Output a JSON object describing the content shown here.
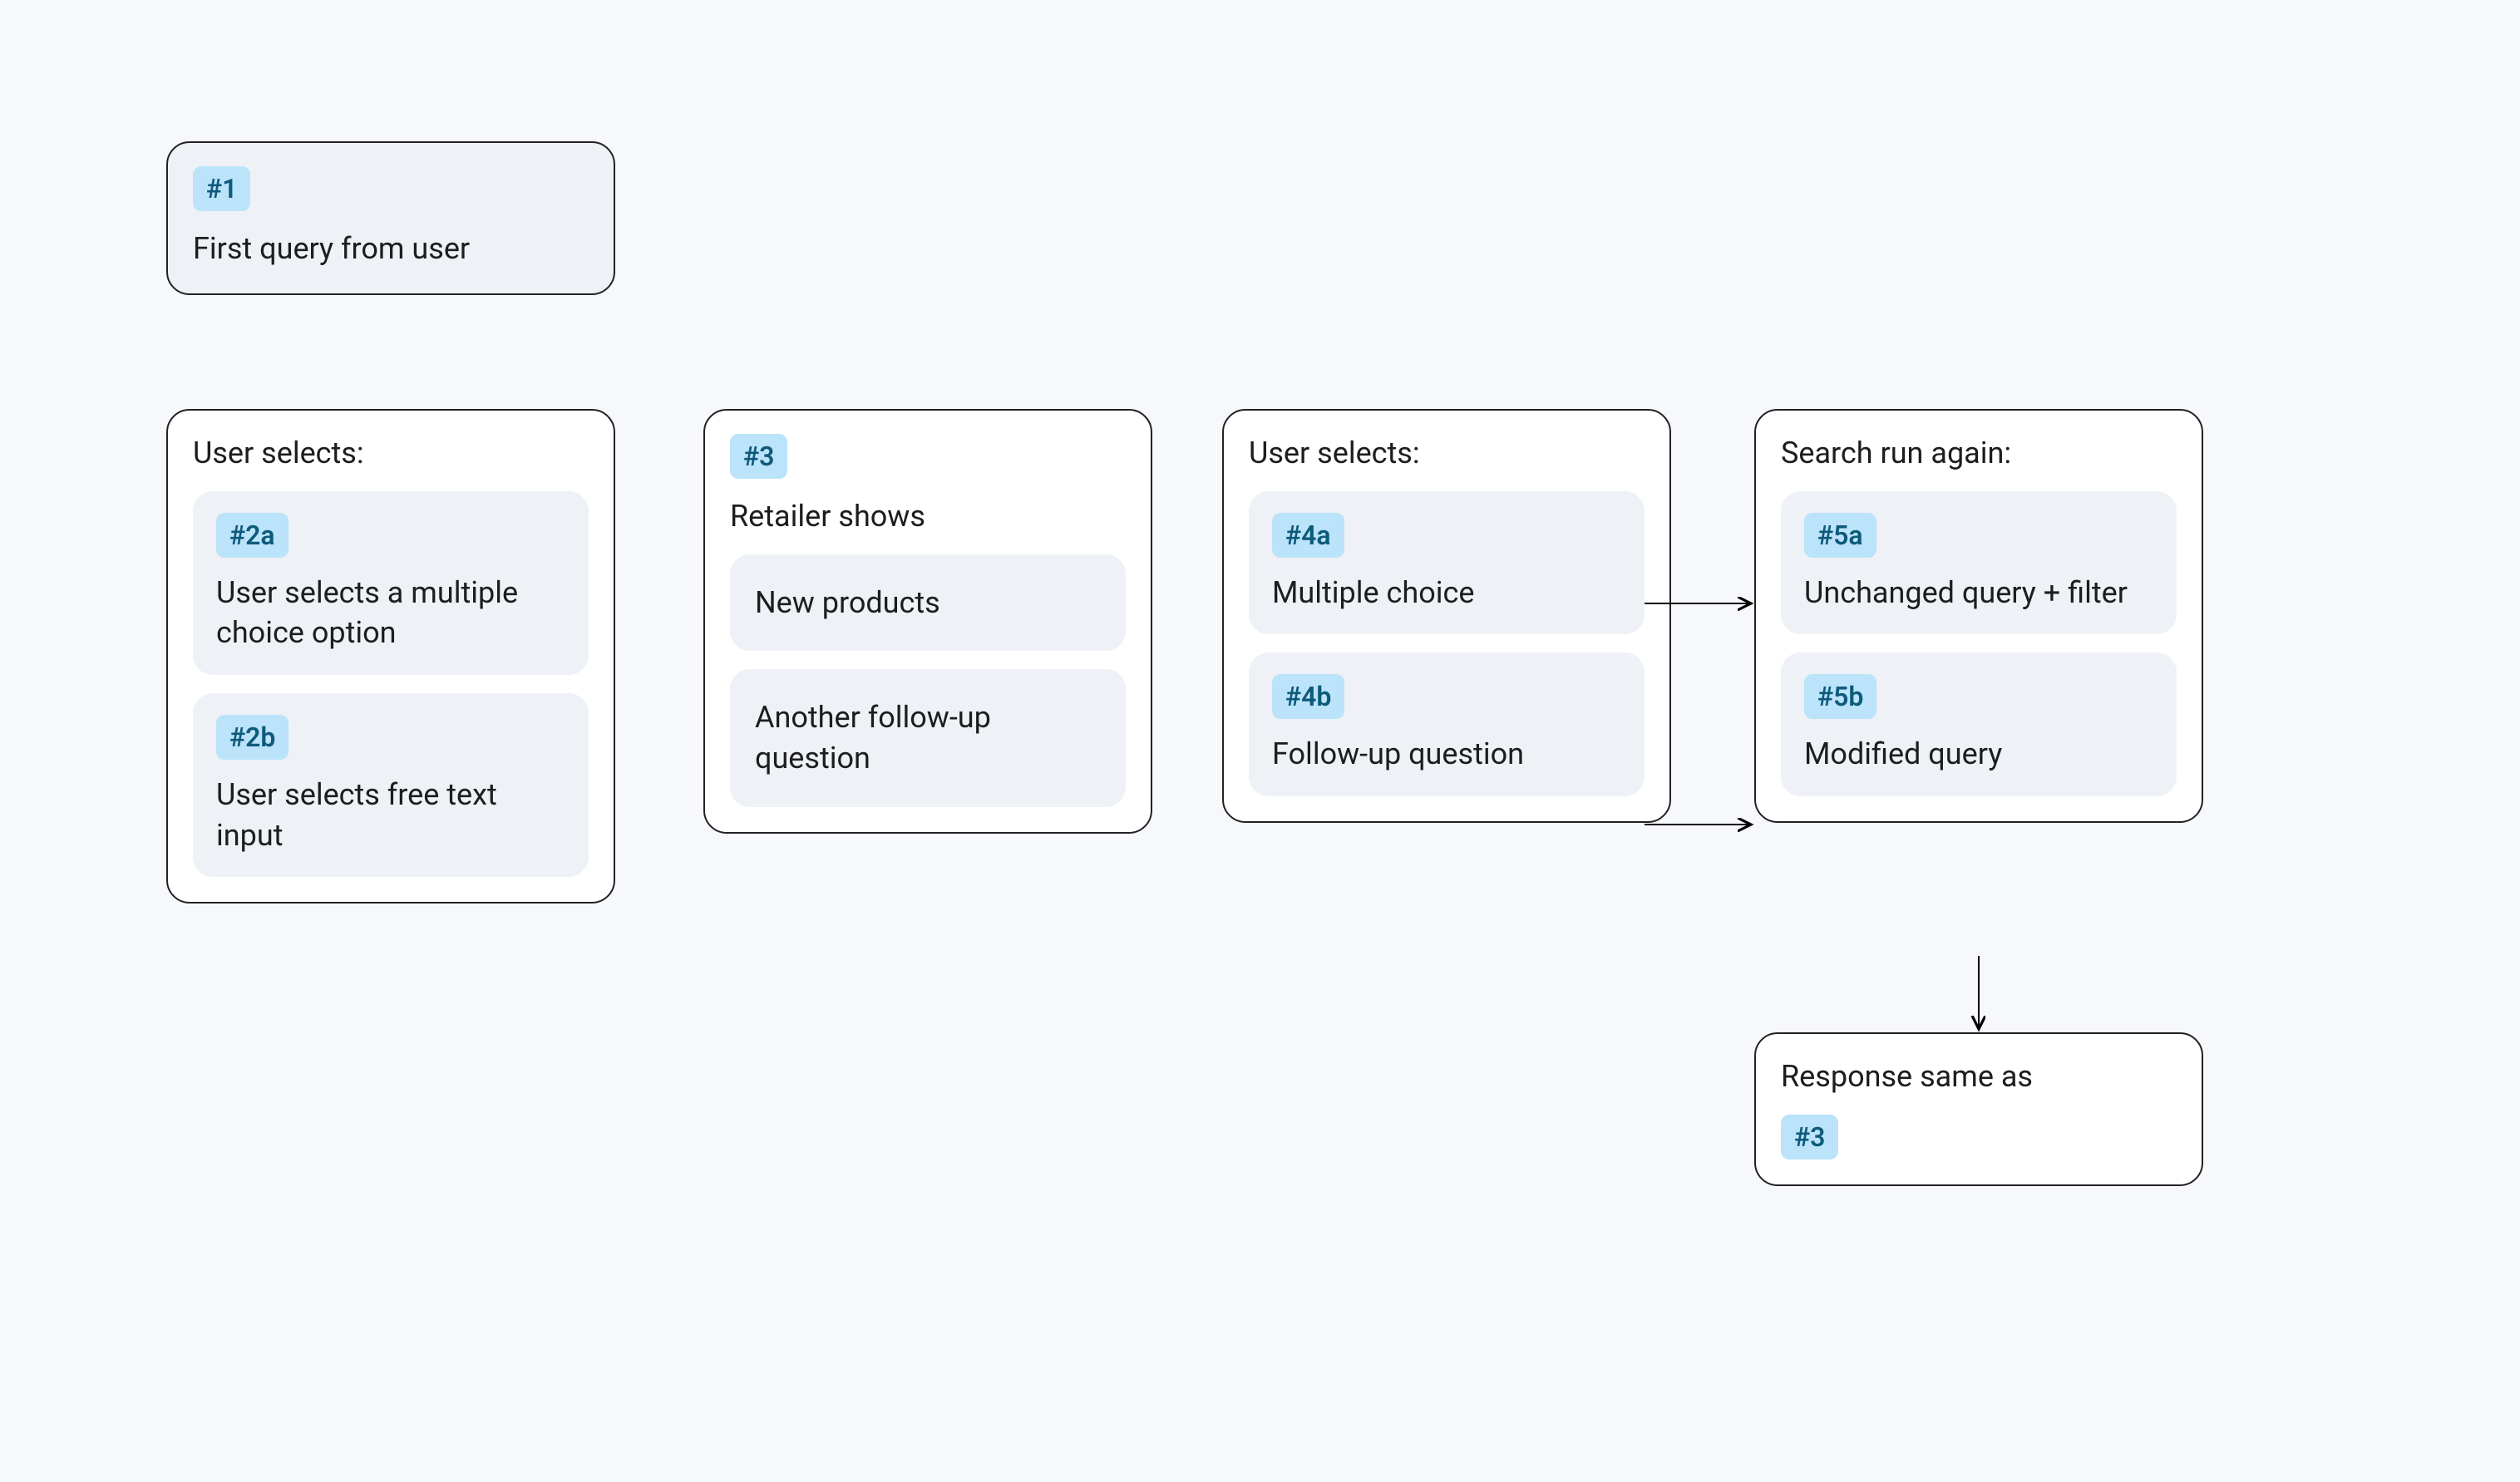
{
  "nodes": {
    "n1": {
      "badge": "#1",
      "text": "First query from user"
    },
    "n2": {
      "title": "User selects:",
      "a": {
        "badge": "#2a",
        "text": "User selects a multiple choice option"
      },
      "b": {
        "badge": "#2b",
        "text": "User selects free text input"
      }
    },
    "n3": {
      "badge": "#3",
      "title": "Retailer shows",
      "a": {
        "text": "New products"
      },
      "b": {
        "text": "Another follow-up question"
      }
    },
    "n4": {
      "title": "User selects:",
      "a": {
        "badge": "#4a",
        "text": "Multiple choice"
      },
      "b": {
        "badge": "#4b",
        "text": "Follow-up question"
      }
    },
    "n5": {
      "title": "Search run again:",
      "a": {
        "badge": "#5a",
        "text": "Unchanged query + filter"
      },
      "b": {
        "badge": "#5b",
        "text": "Modified query"
      }
    },
    "n6": {
      "title": "Response same as",
      "badge": "#3"
    }
  }
}
